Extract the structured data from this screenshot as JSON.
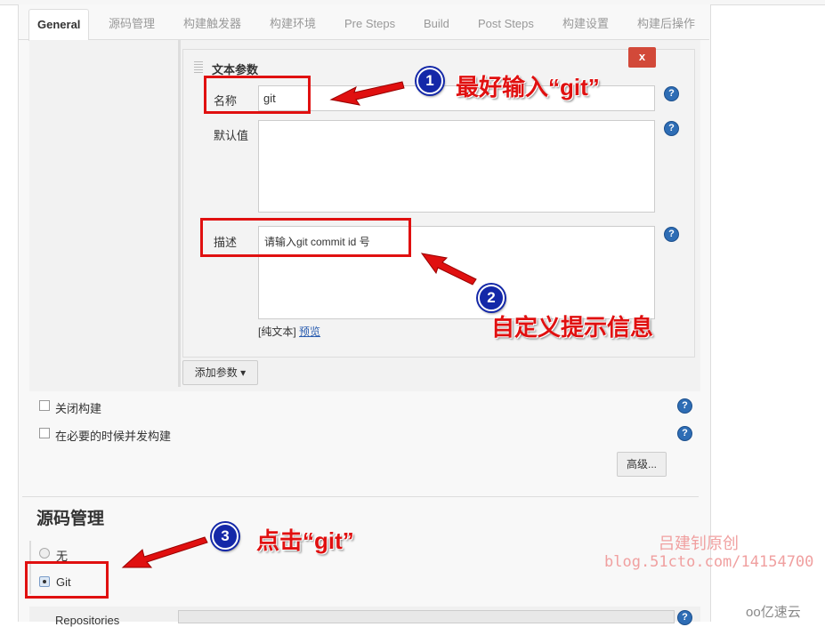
{
  "tabs": [
    "General",
    "源码管理",
    "构建触发器",
    "构建环境",
    "Pre Steps",
    "Build",
    "Post Steps",
    "构建设置",
    "构建后操作"
  ],
  "param": {
    "title": "文本参数",
    "delete": "x",
    "name_label": "名称",
    "name_value": "git",
    "default_label": "默认值",
    "default_value": "",
    "desc_label": "描述",
    "desc_value": "请输入git commit id 号",
    "plain_text": "[纯文本]",
    "preview": "预览",
    "add_param": "添加参数"
  },
  "options": {
    "disable_build": "关闭构建",
    "concurrent_build": "在必要的时候并发构建",
    "advanced": "高级..."
  },
  "scm": {
    "heading": "源码管理",
    "none": "无",
    "git": "Git",
    "git_selected": true,
    "repositories": "Repositories"
  },
  "help": "?",
  "annotations": {
    "n1": "1",
    "t1": "最好输入“git”",
    "n2": "2",
    "t2": "自定义提示信息",
    "n3": "3",
    "t3": "点击“git”"
  },
  "watermark": {
    "line1": "吕建钊原创",
    "line2": "blog.51cto.com/14154700",
    "logo": "亿速云"
  },
  "colors": {
    "annotation": "#e01010",
    "help": "#2e6db5"
  }
}
